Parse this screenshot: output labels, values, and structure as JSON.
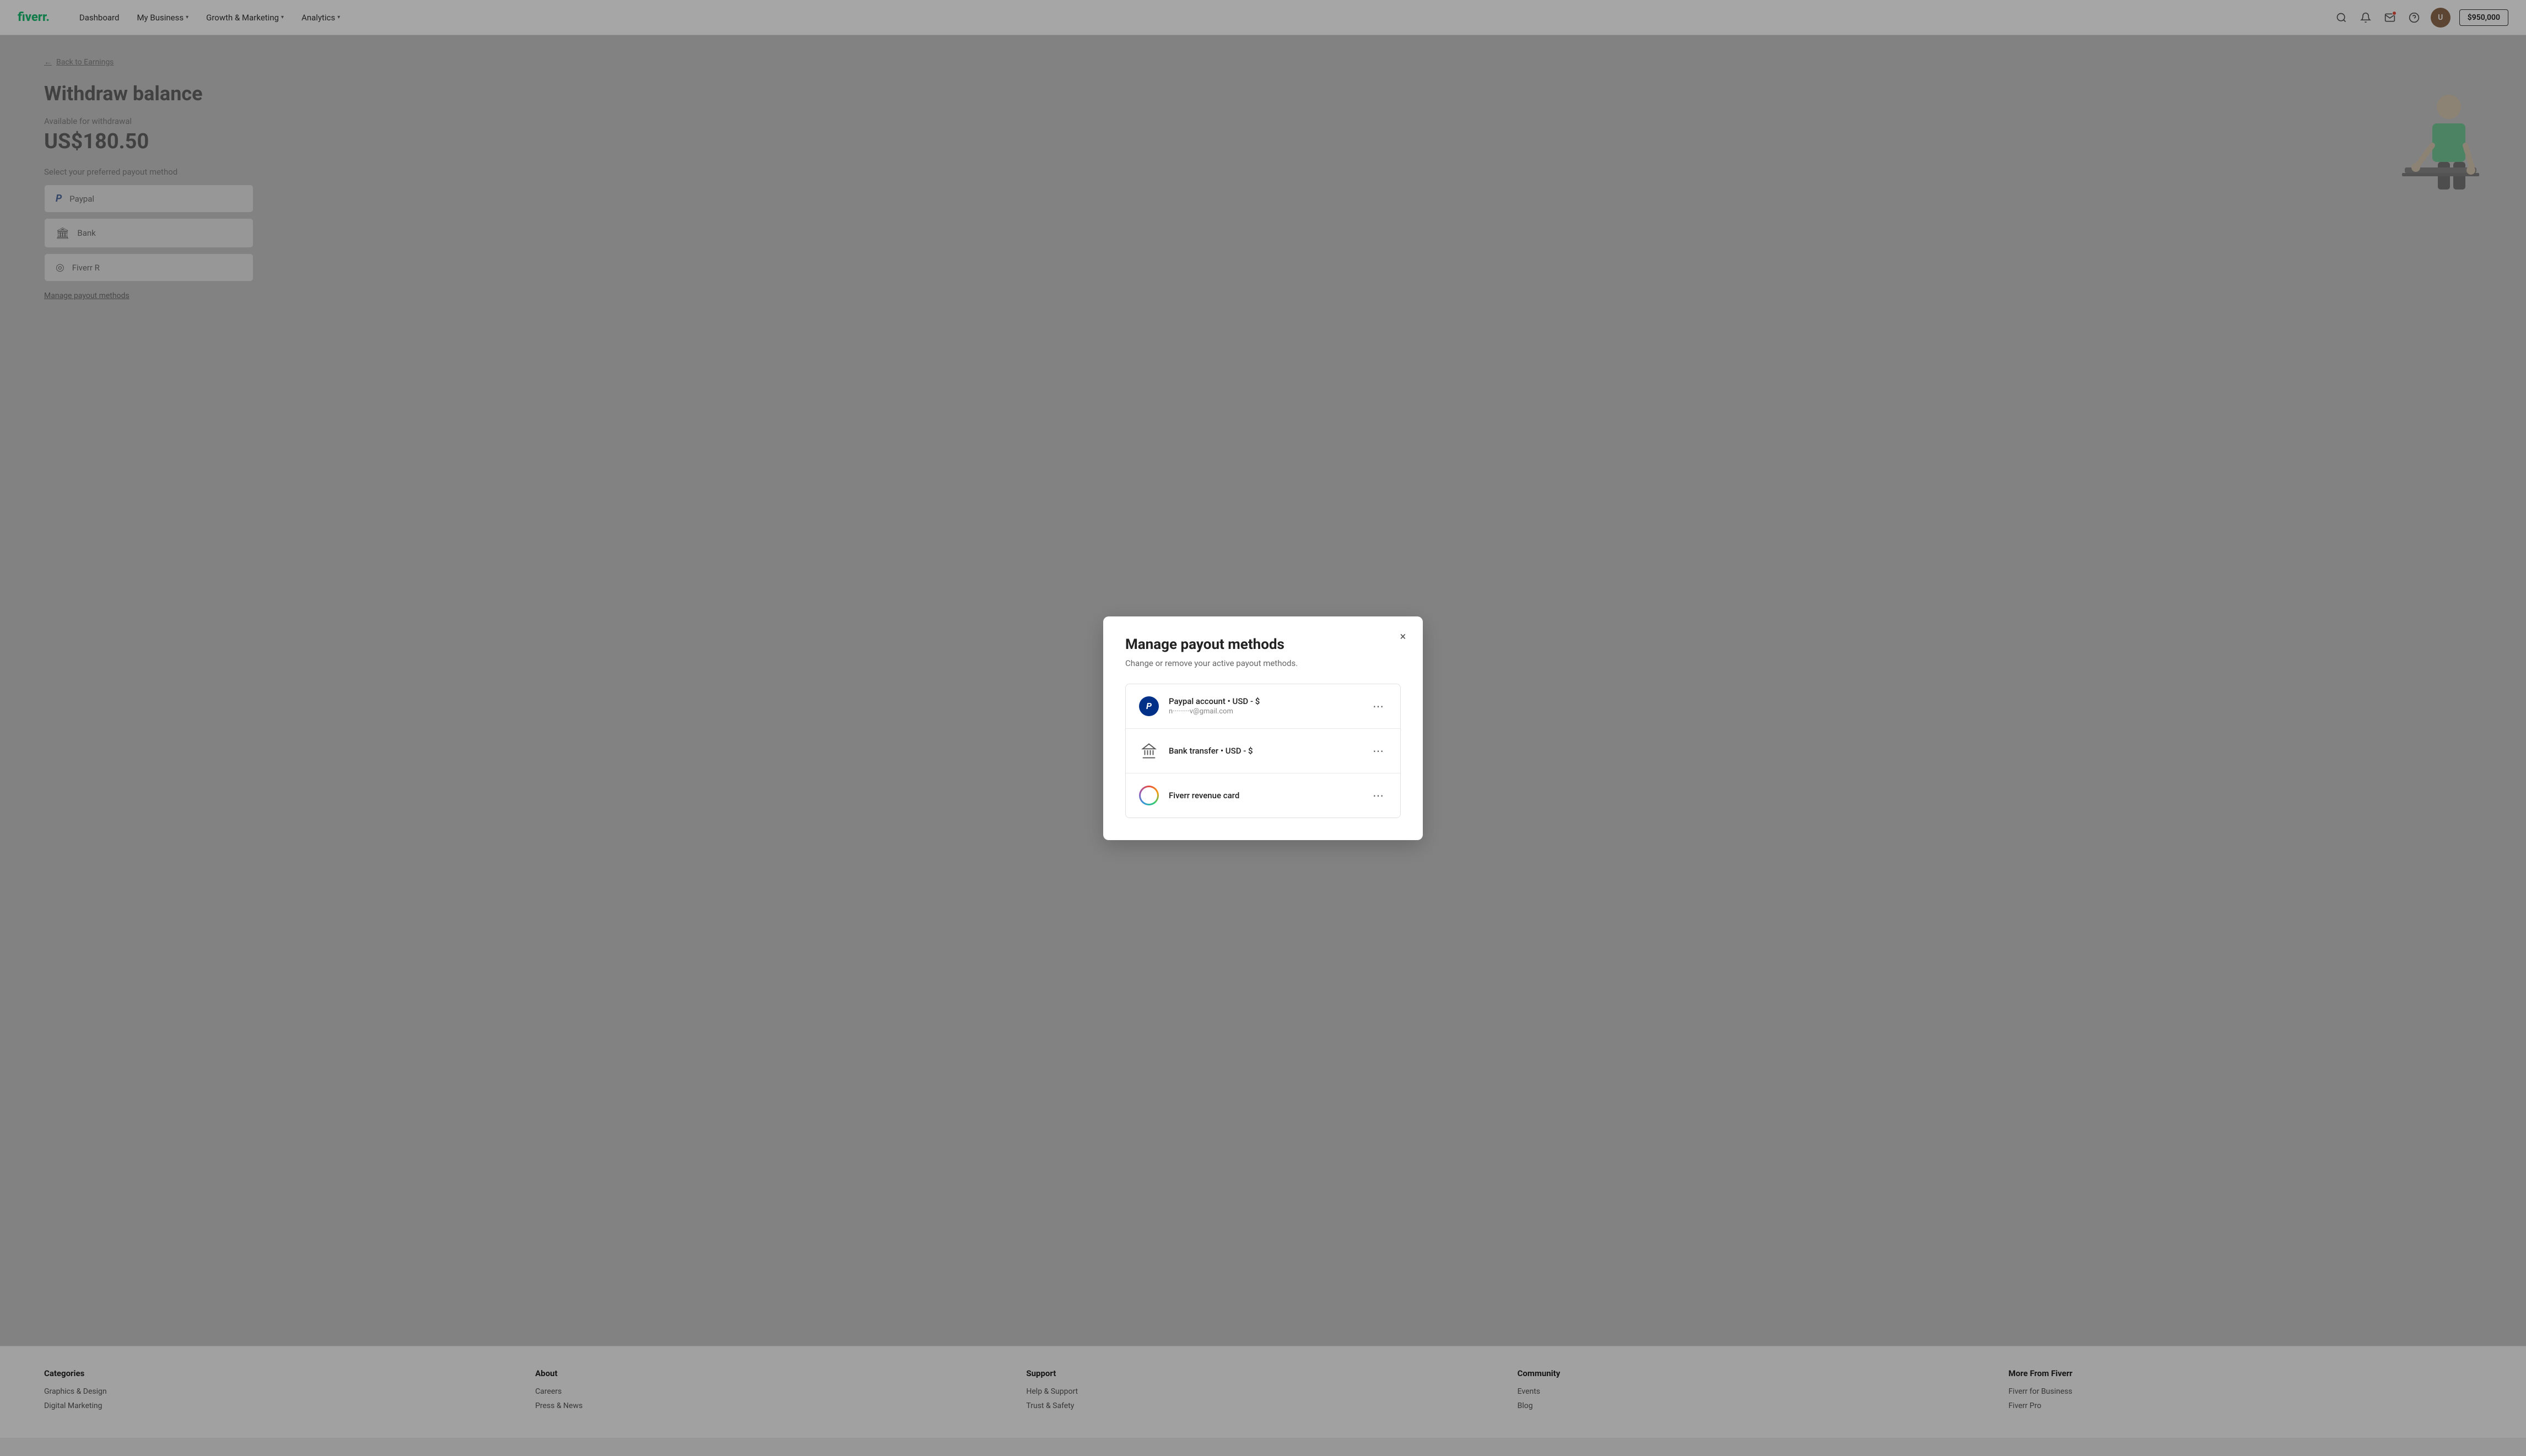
{
  "navbar": {
    "logo": "fiverr.",
    "links": [
      {
        "label": "Dashboard",
        "hasDropdown": false
      },
      {
        "label": "My Business",
        "hasDropdown": true
      },
      {
        "label": "Growth & Marketing",
        "hasDropdown": true
      },
      {
        "label": "Analytics",
        "hasDropdown": true
      }
    ],
    "balance": "$950,000"
  },
  "page": {
    "back_label": "Back to Earnings",
    "title": "Withdraw balance",
    "available_label": "Available for withdrawal",
    "available_amount": "US$180.50",
    "select_label": "Select your preferred payout method",
    "payout_options": [
      {
        "label": "Paypal",
        "icon": "paypal"
      },
      {
        "label": "Bank",
        "icon": "bank"
      },
      {
        "label": "Fiverr R",
        "icon": "fiverr"
      }
    ],
    "manage_label": "Manage payout methods"
  },
  "modal": {
    "title": "Manage payout methods",
    "subtitle": "Change or remove your active payout methods.",
    "close_label": "×",
    "methods": [
      {
        "name": "Paypal account • USD - $",
        "detail": "n·········v@gmail.com",
        "icon": "paypal"
      },
      {
        "name": "Bank transfer • USD - $",
        "detail": "",
        "icon": "bank"
      },
      {
        "name": "Fiverr revenue card",
        "detail": "",
        "icon": "fiverr"
      }
    ],
    "more_label": "⋯"
  },
  "footer": {
    "columns": [
      {
        "title": "Categories",
        "links": [
          "Graphics & Design",
          "Digital Marketing"
        ]
      },
      {
        "title": "About",
        "links": [
          "Careers",
          "Press & News"
        ]
      },
      {
        "title": "Support",
        "links": [
          "Help & Support",
          "Trust & Safety"
        ]
      },
      {
        "title": "Community",
        "links": [
          "Events",
          "Blog"
        ]
      },
      {
        "title": "More From Fiverr",
        "links": [
          "Fiverr for Business",
          "Fiverr Pro"
        ]
      }
    ]
  }
}
